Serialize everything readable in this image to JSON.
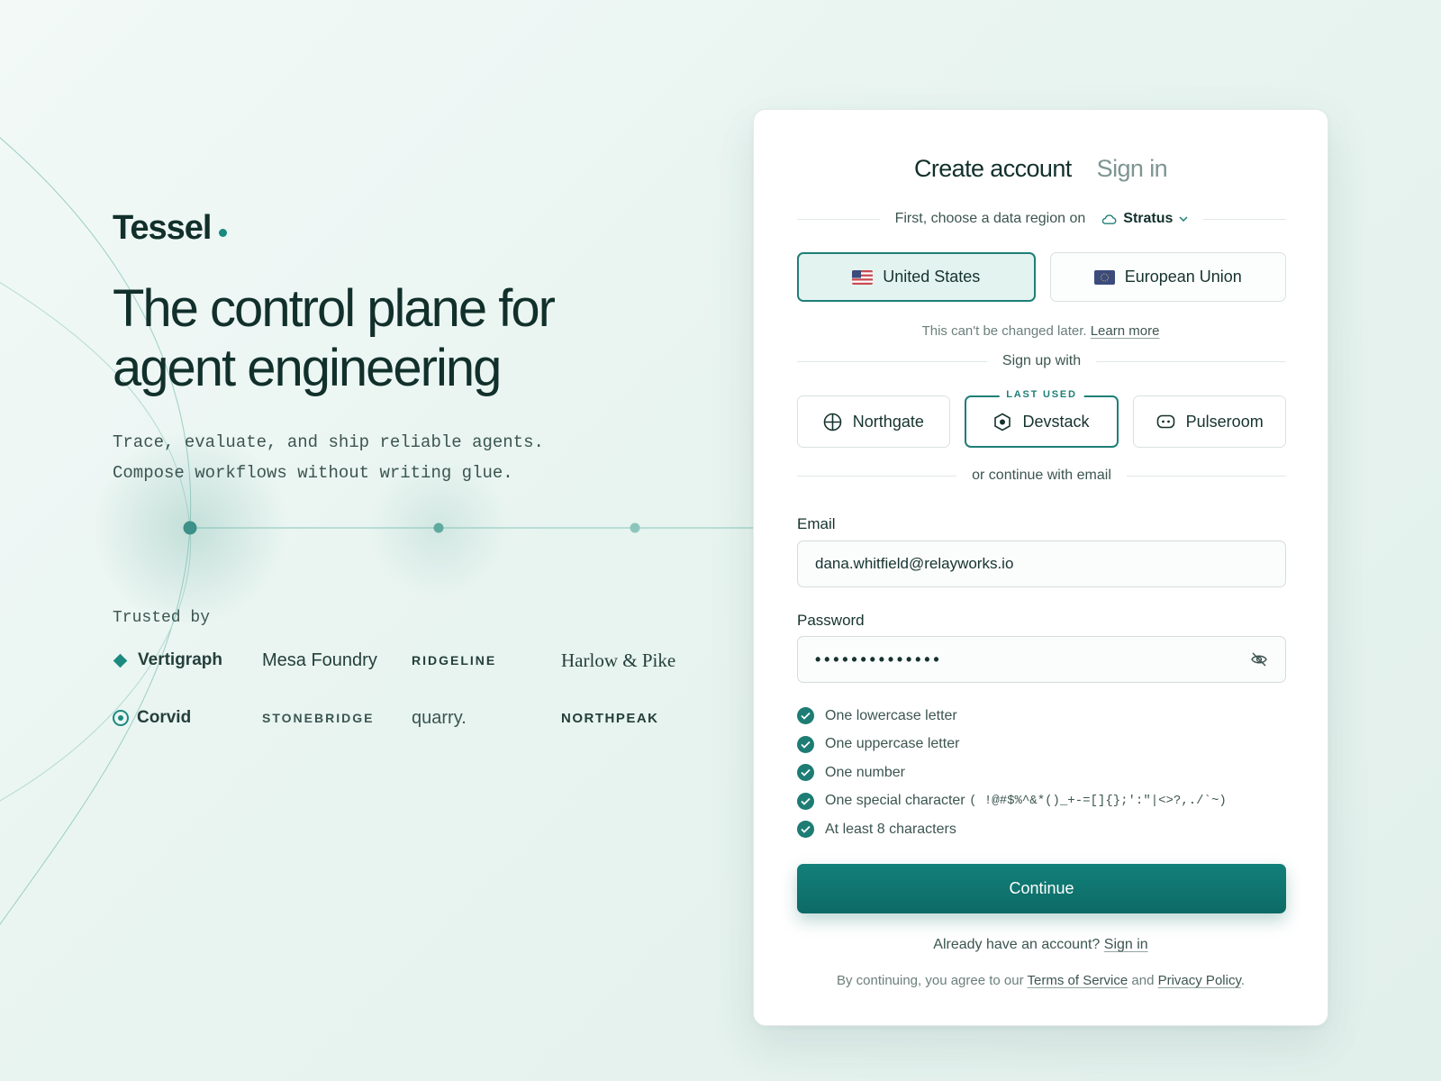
{
  "brand": {
    "name": "Tessel"
  },
  "hero": {
    "headline_line1": "The control plane for",
    "headline_line2": "agent engineering",
    "sub_line1": "Trace, evaluate, and ship reliable agents.",
    "sub_line2": "Compose workflows without writing glue.",
    "trusted_label": "Trusted by",
    "logos": [
      "Vertigraph",
      "Mesa Foundry",
      "RIDGELINE",
      "Harlow & Pike",
      "Corvid",
      "STONEBRIDGE",
      "quarry.",
      "NORTHPEAK"
    ]
  },
  "auth": {
    "tabs": {
      "create": "Create account",
      "signin": "Sign in"
    },
    "region_prompt": "First, choose a data region on",
    "provider": "Stratus",
    "regions": [
      {
        "label": "United States",
        "selected": true
      },
      {
        "label": "European Union",
        "selected": false
      }
    ],
    "region_note": "This can't be changed later.",
    "learn_more": "Learn more",
    "signup_with": "Sign up with",
    "sso": [
      {
        "label": "Northgate",
        "icon": "globe-icon"
      },
      {
        "label": "Devstack",
        "icon": "hexagon-icon",
        "badge": "LAST USED"
      },
      {
        "label": "Pulseroom",
        "icon": "chat-bubble-icon"
      }
    ],
    "or_email": "or continue with email",
    "email_label": "Email",
    "email_value": "dana.whitfield@relayworks.io",
    "password_label": "Password",
    "password_mask": "••••••••••••••",
    "rules": [
      "One lowercase letter",
      "One uppercase letter",
      "One number",
      "One special character",
      "At least 8 characters"
    ],
    "special_chars": "( !@#$%^&*()_+-=[]{};':\"|<>?,./`~)",
    "continue": "Continue",
    "have_account": "Already have an account?",
    "signin_link": "Sign in",
    "legal_prefix": "By continuing, you agree to our",
    "terms": "Terms of Service",
    "and": "and",
    "privacy": "Privacy Policy",
    "period": "."
  },
  "colors": {
    "accent": "#1e7f77",
    "button": "#0f746e",
    "text": "#16332e"
  }
}
